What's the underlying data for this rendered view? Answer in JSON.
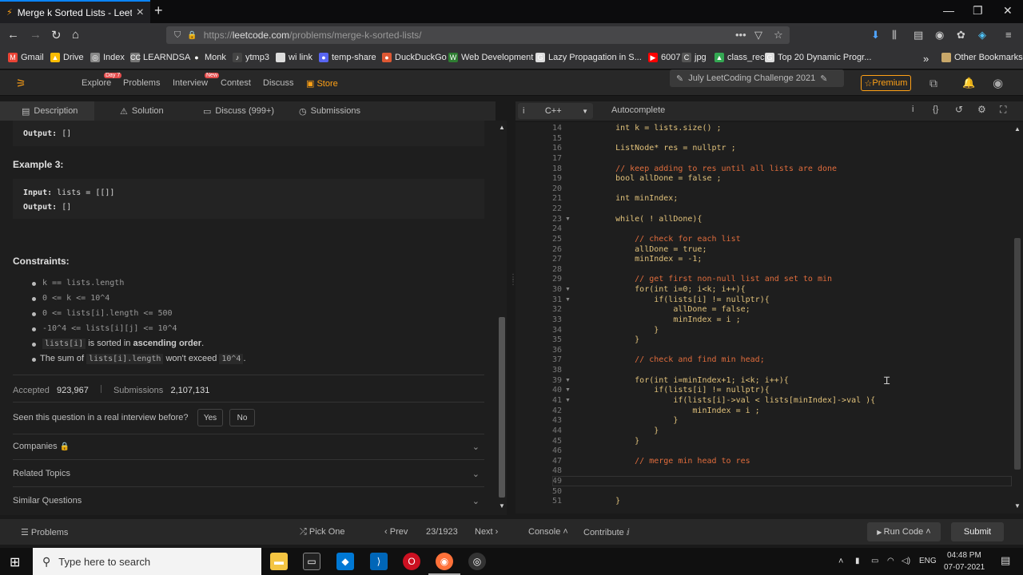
{
  "browser": {
    "tab_title": "Merge k Sorted Lists - LeetCode",
    "url": "https://leetcode.com/problems/merge-k-sorted-lists/",
    "url_prefix": "https://",
    "url_host": "leetcode.com",
    "url_path": "/problems/merge-k-sorted-lists/"
  },
  "bookmarks": [
    {
      "label": "Gmail",
      "color": "#ea4335",
      "glyph": "M"
    },
    {
      "label": "Drive",
      "color": "#fbbc04",
      "glyph": "▲"
    },
    {
      "label": "Index",
      "color": "#888888",
      "glyph": "◎"
    },
    {
      "label": "LEARNDSA",
      "color": "#777777",
      "glyph": "CC"
    },
    {
      "label": "Monk",
      "color": "#333333",
      "glyph": "●"
    },
    {
      "label": "ytmp3",
      "color": "#444444",
      "glyph": "♪"
    },
    {
      "label": "wi link",
      "color": "#dddddd",
      "glyph": ""
    },
    {
      "label": "temp-share",
      "color": "#5865f2",
      "glyph": "●"
    },
    {
      "label": "DuckDuckGo",
      "color": "#de5833",
      "glyph": "●"
    },
    {
      "label": "Web Development",
      "color": "#2e7d32",
      "glyph": "W"
    },
    {
      "label": "Lazy Propagation in S...",
      "color": "#dddddd",
      "glyph": "G"
    },
    {
      "label": "6007",
      "color": "#ff0000",
      "glyph": "▶"
    },
    {
      "label": "jpg",
      "color": "#555555",
      "glyph": "C"
    },
    {
      "label": "class_rec",
      "color": "#34a853",
      "glyph": "▲"
    },
    {
      "label": "Top 20 Dynamic Progr...",
      "color": "#dddddd",
      "glyph": "G"
    }
  ],
  "bookmarks_other": "Other Bookmarks",
  "lcnav": {
    "explore": "Explore",
    "explore_badge": "Day 7",
    "problems": "Problems",
    "interview": "Interview",
    "interview_badge": "New",
    "contest": "Contest",
    "discuss": "Discuss",
    "store": "Store",
    "challenge": "July LeetCoding Challenge 2021",
    "premium": "Premium"
  },
  "lefttabs": {
    "description": "Description",
    "solution": "Solution",
    "discuss": "Discuss (999+)",
    "submissions": "Submissions"
  },
  "problem": {
    "output_label": "Output:",
    "output_val1": "[]",
    "example3_title": "Example 3:",
    "input_label": "Input:",
    "input_val": "lists = [[]]",
    "output_val2": "[]",
    "constraints_title": "Constraints:",
    "constraints": [
      "k == lists.length",
      "0 <= k <= 10^4",
      "0 <= lists[i].length <= 500",
      "-10^4 <= lists[i][j] <= 10^4"
    ],
    "c5_code": "lists[i]",
    "c5_text": " is sorted in ",
    "c5_bold": "ascending order",
    "c5_end": ".",
    "c6_text": "The sum of ",
    "c6_code": "lists[i].length",
    "c6_mid": " won't exceed ",
    "c6_code2": "10^4",
    "c6_end": ".",
    "accepted_label": "Accepted",
    "accepted_val": "923,967",
    "submissions_label": "Submissions",
    "submissions_val": "2,107,131",
    "interview_q": "Seen this question in a real interview before?",
    "yes": "Yes",
    "no": "No",
    "companies": "Companies",
    "related": "Related Topics",
    "similar": "Similar Questions"
  },
  "editor": {
    "language": "C++",
    "autocomplete": "Autocomplete",
    "lines": [
      {
        "n": "14",
        "t": "    int k = lists.size() ;"
      },
      {
        "n": "15",
        "t": ""
      },
      {
        "n": "16",
        "t": "    ListNode* res = nullptr ;"
      },
      {
        "n": "17",
        "t": ""
      },
      {
        "n": "18",
        "t": "    // keep adding to res until all lists are done"
      },
      {
        "n": "19",
        "t": "    bool allDone = false ;"
      },
      {
        "n": "20",
        "t": ""
      },
      {
        "n": "21",
        "t": "    int minIndex;"
      },
      {
        "n": "22",
        "t": ""
      },
      {
        "n": "23",
        "t": "    while( ! allDone){"
      },
      {
        "n": "24",
        "t": ""
      },
      {
        "n": "25",
        "t": "        // check for each list"
      },
      {
        "n": "26",
        "t": "        allDone = true;"
      },
      {
        "n": "27",
        "t": "        minIndex = -1;"
      },
      {
        "n": "28",
        "t": ""
      },
      {
        "n": "29",
        "t": "        // get first non-null list and set to min"
      },
      {
        "n": "30",
        "t": "        for(int i=0; i<k; i++){"
      },
      {
        "n": "31",
        "t": "            if(lists[i] != nullptr){"
      },
      {
        "n": "32",
        "t": "                allDone = false;"
      },
      {
        "n": "33",
        "t": "                minIndex = i ;"
      },
      {
        "n": "34",
        "t": "            }"
      },
      {
        "n": "35",
        "t": "        }"
      },
      {
        "n": "36",
        "t": ""
      },
      {
        "n": "37",
        "t": "        // check and find min head;"
      },
      {
        "n": "38",
        "t": ""
      },
      {
        "n": "39",
        "t": "        for(int i=minIndex+1; i<k; i++){"
      },
      {
        "n": "40",
        "t": "            if(lists[i] != nullptr){"
      },
      {
        "n": "41",
        "t": "                if(lists[i]->val < lists[minIndex]->val ){"
      },
      {
        "n": "42",
        "t": "                    minIndex = i ;"
      },
      {
        "n": "43",
        "t": "                }"
      },
      {
        "n": "44",
        "t": "            }"
      },
      {
        "n": "45",
        "t": "        }"
      },
      {
        "n": "46",
        "t": ""
      },
      {
        "n": "47",
        "t": "        // merge min head to res"
      },
      {
        "n": "48",
        "t": ""
      },
      {
        "n": "49",
        "t": ""
      },
      {
        "n": "50",
        "t": ""
      },
      {
        "n": "51",
        "t": "    }"
      }
    ],
    "fold_lines": [
      "23",
      "30",
      "31",
      "39",
      "40",
      "41"
    ]
  },
  "bottom": {
    "problems": "Problems",
    "pick_one": "Pick One",
    "prev": "Prev",
    "page": "23/1923",
    "next": "Next",
    "console": "Console",
    "contribute": "Contribute",
    "run": "Run Code",
    "submit": "Submit"
  },
  "taskbar": {
    "search_placeholder": "Type here to search",
    "lang": "ENG",
    "time": "04:48 PM",
    "date": "07-07-2021"
  }
}
